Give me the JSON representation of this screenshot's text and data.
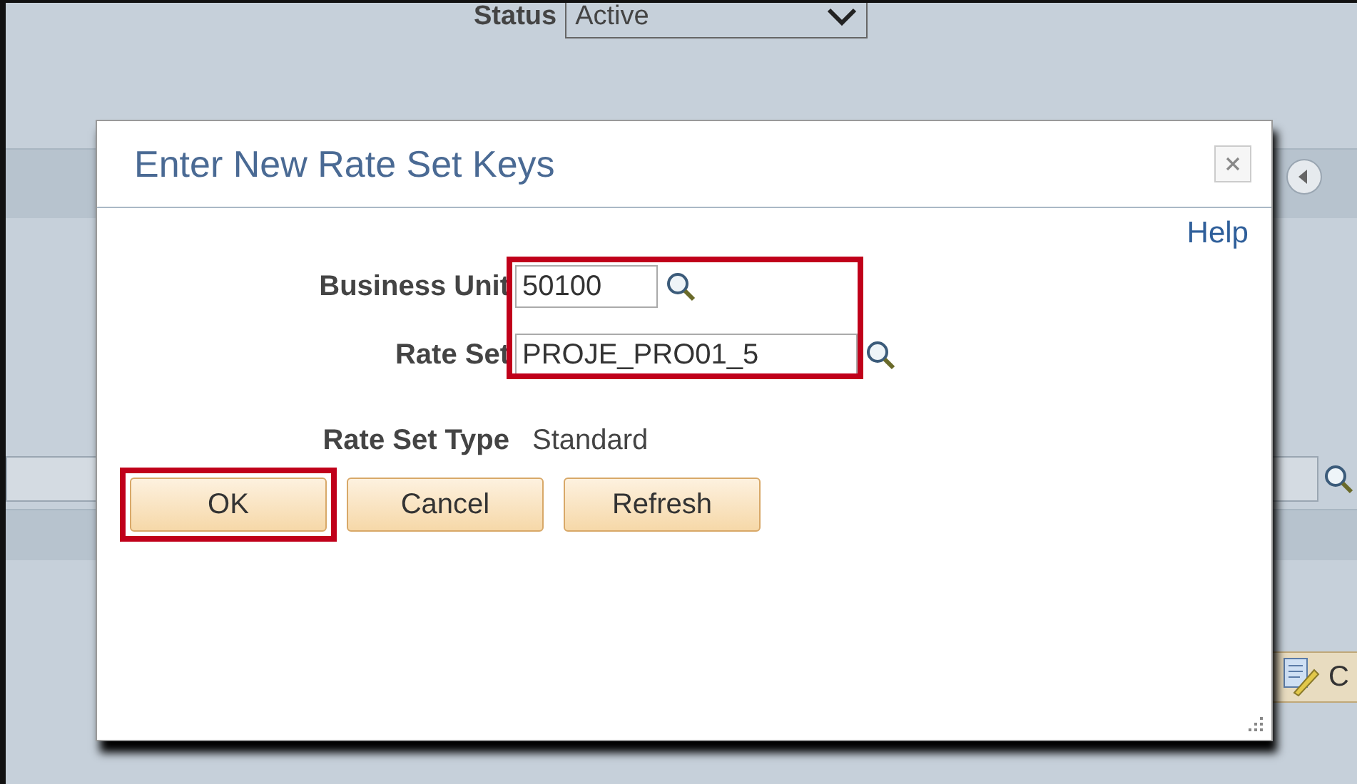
{
  "background": {
    "status_label": "Status",
    "status_value": "Active",
    "action_button_label": "C"
  },
  "dialog": {
    "title": "Enter New Rate Set Keys",
    "help_link": "Help",
    "fields": [
      {
        "label": "Business Unit",
        "value": "50100",
        "kind": "short"
      },
      {
        "label": "Rate Set",
        "value": "PROJE_PRO01_5",
        "kind": "long"
      }
    ],
    "info": {
      "label": "Rate Set Type",
      "value": "Standard"
    },
    "buttons": [
      {
        "label": "OK",
        "highlighted": true
      },
      {
        "label": "Cancel",
        "highlighted": false
      },
      {
        "label": "Refresh",
        "highlighted": false
      }
    ]
  }
}
